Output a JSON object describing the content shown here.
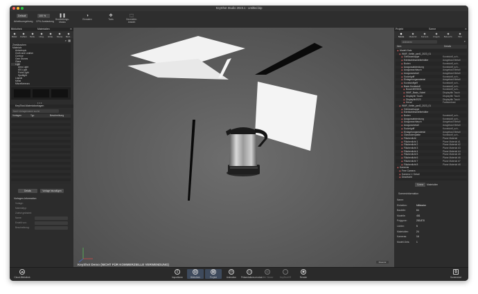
{
  "window": {
    "title": "KeyShot Studio 2023.1 - untitled.bip"
  },
  "toolbar": {
    "workspace_value": "Default",
    "workspace_label": "Arbeitsumgebung",
    "cpu_value": "100 %",
    "cpu_label": "CPU-Auslastung",
    "buttons": [
      {
        "label": "Bearbeitungs-\nModus",
        "icon": "pause-icon",
        "glyph": "❚❚"
      },
      {
        "label": "Einrasten",
        "icon": "snap-icon",
        "glyph": "◑"
      },
      {
        "label": "Tools",
        "icon": "tools-icon",
        "glyph": "✥"
      },
      {
        "label": "Geometrie-\nAnsicht",
        "icon": "geometry-view-icon",
        "glyph": "⬚"
      }
    ]
  },
  "left_panel": {
    "header_title": "Bibliothek",
    "header_subtitle": "Materialien",
    "tabs": [
      "Mater.",
      "Farben",
      "Textu.",
      "Umg.",
      "Hinte.",
      "Szene",
      "Mod..."
    ],
    "tree": [
      {
        "label": "Zinntäuschen",
        "indent": 0
      },
      {
        "label": "Materials",
        "indent": 0
      },
      {
        "label": "Anisotropic",
        "indent": 1
      },
      {
        "label": "Cloth and Leather",
        "indent": 1
      },
      {
        "label": "Contour",
        "indent": 1
      },
      {
        "label": "Gem Stones",
        "indent": 1
      },
      {
        "label": "Glass",
        "indent": 1
      },
      {
        "label": "Light",
        "indent": 1
      },
      {
        "label": "Area Light",
        "indent": 2
      },
      {
        "label": "IES Light",
        "indent": 2
      },
      {
        "label": "Point Light",
        "indent": 2
      },
      {
        "label": "Spotlight",
        "indent": 2
      },
      {
        "label": "Liquids",
        "indent": 1
      },
      {
        "label": "Metal",
        "indent": 1
      },
      {
        "label": "Miscellaneous",
        "indent": 1
      }
    ],
    "template_section_title": "KeyShot-Materialvorlagen",
    "search_placeholder": "Nach Vorlagenname suche",
    "columns": [
      "Vorlagen",
      "Typ",
      "Beschreibung"
    ],
    "btn_details": "Details",
    "btn_add_template": "Vorlage hinzufügen",
    "info_title": "Vorlagen-Information",
    "info_fields": [
      "Vorlage:",
      "Materialtyp:",
      "Zuletzt geändert:",
      "Name:",
      "Erstellt von:",
      "Beschreibung:"
    ]
  },
  "viewport": {
    "watermark": "KeyShot Demo (NICHT FÜR KOMMERZIELLE VERWENDUNG)",
    "overlay_value": "Material"
  },
  "right_panel": {
    "header_left": "Projekt",
    "header_right": "Szene",
    "tabs": [
      "Szene",
      "Material",
      "Kamera",
      "Umgeb.",
      "Beleucht.",
      "Bild"
    ],
    "search_placeholder": "Aktivieren",
    "col_item": "Item",
    "col_details": "Details",
    "tree": [
      {
        "label": "Modell-Satz",
        "indent": 0,
        "detail": ""
      },
      {
        "label": "WMF_Kettle_part1_2023_01",
        "indent": 1,
        "detail": ""
      },
      {
        "label": "Gehäusekappe",
        "indent": 2,
        "detail": "Kunststoff_sch..."
      },
      {
        "label": "Edelstahlmantelbehälter",
        "indent": 2,
        "detail": "Ausgebaut Metall"
      },
      {
        "label": "Boden",
        "indent": 2,
        "detail": "Kunststoff_sch..."
      },
      {
        "label": "Ausgussabdeckung",
        "indent": 2,
        "detail": "Kunststoff_sch..."
      },
      {
        "label": "Ausgussschlauch",
        "indent": 2,
        "detail": "Ausgebaut Metall"
      },
      {
        "label": "Ausgussmetall",
        "indent": 2,
        "detail": "Ausgebaut Metall"
      },
      {
        "label": "Sockelgriff",
        "indent": 2,
        "detail": "Kunststoff_sch..."
      },
      {
        "label": "Einlagerungsmaterial",
        "indent": 2,
        "detail": "Ausgebaut Metall"
      },
      {
        "label": "Kunststoffgriff",
        "indent": 2,
        "detail": "Kunststoff_sch..."
      },
      {
        "label": "Basis Kunststoff",
        "indent": 2,
        "detail": "Kunststoff_sch..."
      },
      {
        "label": "Bosch3EE5531",
        "indent": 3,
        "detail": "Kunststoff_sch..."
      },
      {
        "label": "WMF_Basis_Kabel",
        "indent": 3,
        "detail": "Displaytfin Touch"
      },
      {
        "label": "Displayfin Touch",
        "indent": 3,
        "detail": "Displaytfin Touch"
      },
      {
        "label": "Displayfin2023",
        "indent": 3,
        "detail": "Displaytfin Touch"
      },
      {
        "label": "Decal",
        "indent": 3,
        "detail": "Farbkontrast"
      },
      {
        "label": "WMF_Kettle_part2_2023_01",
        "indent": 1,
        "detail": ""
      },
      {
        "label": "Gehäusekappe",
        "indent": 2,
        "detail": ""
      },
      {
        "label": "Edelstahlmantelbehälter",
        "indent": 2,
        "detail": ""
      },
      {
        "label": "Boden",
        "indent": 2,
        "detail": "Kunststoff_sch..."
      },
      {
        "label": "Ausgussabdeckung",
        "indent": 2,
        "detail": "Kunststoff_sch..."
      },
      {
        "label": "Ausgussschlauch",
        "indent": 2,
        "detail": "Ausgebaut Metall"
      },
      {
        "label": "Ausgussmetall",
        "indent": 2,
        "detail": "Ausgebaut Metall"
      },
      {
        "label": "Sockelgriff",
        "indent": 2,
        "detail": "Kunststoff_sch..."
      },
      {
        "label": "Einlagerungsmaterial",
        "indent": 2,
        "detail": "Ausgebaut Metall"
      },
      {
        "label": "Glasbodenplatte",
        "indent": 2,
        "detail": "Kunststoff_sch..."
      },
      {
        "label": "Flächenlicht",
        "indent": 2,
        "detail": "Plane Material"
      },
      {
        "label": "Flächenlicht 1",
        "indent": 2,
        "detail": "Plane Material #1"
      },
      {
        "label": "Flächenlicht 2",
        "indent": 2,
        "detail": "Plane Material #2"
      },
      {
        "label": "Flächenlicht 3",
        "indent": 2,
        "detail": "Plane Material #3"
      },
      {
        "label": "Flächenlicht 4",
        "indent": 2,
        "detail": "Plane Material #4"
      },
      {
        "label": "Flächenlicht 5",
        "indent": 2,
        "detail": "Plane Material #5"
      },
      {
        "label": "Flächenlicht 6",
        "indent": 2,
        "detail": "Plane Material #6"
      },
      {
        "label": "Flächenlicht 7",
        "indent": 2,
        "detail": "Plane Material #7"
      },
      {
        "label": "Flächenlicht 8",
        "indent": 2,
        "detail": "Plane Material #8"
      },
      {
        "label": "Kameras",
        "indent": 0,
        "detail": ""
      },
      {
        "label": "Free Camera",
        "indent": 1,
        "detail": ""
      },
      {
        "label": "Kamera 1 / Detail",
        "indent": 1,
        "detail": ""
      },
      {
        "label": "Draufsicht",
        "indent": 1,
        "detail": ""
      }
    ],
    "subtabs": [
      "Szene",
      "Materialien"
    ],
    "info_title": "Szeneninformation",
    "info_rows": [
      {
        "k": "Name:",
        "v": ""
      },
      {
        "k": "Einheiten:",
        "v": "Millimeter"
      },
      {
        "k": "Bauteile:",
        "v": "64"
      },
      {
        "k": "Modelle:",
        "v": "451"
      },
      {
        "k": "Polygone:",
        "v": "253.870"
      },
      {
        "k": "Lichter:",
        "v": "5"
      },
      {
        "k": "Materialien:",
        "v": "24"
      },
      {
        "k": "Kameras:",
        "v": "16"
      },
      {
        "k": "Modell-Sets:",
        "v": "1"
      }
    ]
  },
  "bottom_bar": {
    "left_label": "Cloud-Bibliothek",
    "buttons": [
      {
        "label": "Importieren",
        "glyph": "↧",
        "icon": "import-icon",
        "active": false
      },
      {
        "label": "Bibliothek",
        "glyph": "▤",
        "icon": "library-icon",
        "active": true
      },
      {
        "label": "Projekt",
        "glyph": "▦",
        "icon": "project-icon",
        "active": true
      },
      {
        "label": "Animation",
        "glyph": "◷",
        "icon": "animation-icon",
        "active": false
      },
      {
        "label": "Präsentations-modus",
        "glyph": "▭",
        "icon": "presentation-icon",
        "active": false
      },
      {
        "label": "Web Viewer",
        "glyph": "◎",
        "icon": "web-viewer-icon",
        "active": false
      },
      {
        "label": "KeyShotXR",
        "glyph": "◌",
        "icon": "keyshotxr-icon",
        "active": false
      },
      {
        "label": "Render",
        "glyph": "◉",
        "icon": "render-icon",
        "active": false
      }
    ],
    "right_label": "Screenshot"
  }
}
